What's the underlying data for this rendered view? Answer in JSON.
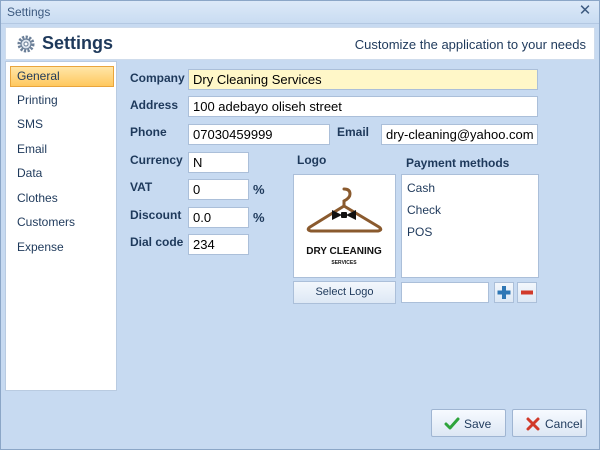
{
  "window": {
    "title": "Settings",
    "close_glyph": "✕"
  },
  "header": {
    "title": "Settings",
    "subtitle": "Customize the application to your needs",
    "icon": "gear-icon"
  },
  "sidebar": {
    "items": [
      {
        "label": "General",
        "active": true
      },
      {
        "label": "Printing"
      },
      {
        "label": "SMS"
      },
      {
        "label": "Email"
      },
      {
        "label": "Data"
      },
      {
        "label": "Clothes"
      },
      {
        "label": "Customers"
      },
      {
        "label": "Expense"
      }
    ]
  },
  "general": {
    "company_label": "Company",
    "company_value": "Dry Cleaning Services",
    "address_label": "Address",
    "address_value": "100 adebayo oliseh street",
    "phone_label": "Phone",
    "phone_value": "07030459999",
    "email_label": "Email",
    "email_value": "dry-cleaning@yahoo.com",
    "currency_label": "Currency",
    "currency_value": "N",
    "vat_label": "VAT",
    "vat_value": "0",
    "vat_unit": "%",
    "discount_label": "Discount",
    "discount_value": "0.0",
    "discount_unit": "%",
    "dialcode_label": "Dial code",
    "dialcode_value": "234",
    "logo_label": "Logo",
    "logo_text_line1": "DRY CLEANING",
    "logo_text_line2": "SERVICES",
    "select_logo_label": "Select Logo",
    "payment_label": "Payment methods",
    "payment_methods": [
      "Cash",
      "Check",
      "POS"
    ]
  },
  "footer": {
    "save_label": "Save",
    "cancel_label": "Cancel"
  },
  "colors": {
    "accent": "#1e395b",
    "active_tab": "#ffc85e",
    "window_bg": "#c7daf1",
    "highlight_field": "#fff7c8"
  }
}
